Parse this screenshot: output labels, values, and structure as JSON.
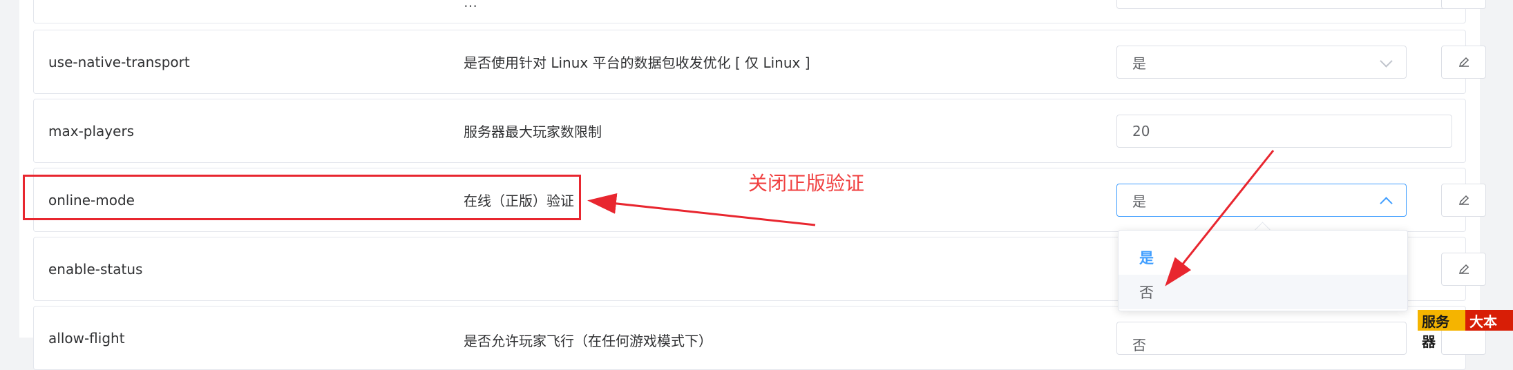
{
  "rows": [
    {
      "key": "",
      "desc": "…",
      "value": "",
      "type": "select"
    },
    {
      "key": "use-native-transport",
      "desc": "是否使用针对 Linux 平台的数据包收发优化 [ 仅 Linux ]",
      "value": "是",
      "type": "select"
    },
    {
      "key": "max-players",
      "desc": "服务器最大玩家数限制",
      "value": "20",
      "type": "input"
    },
    {
      "key": "online-mode",
      "desc": "在线（正版）验证",
      "value": "是",
      "type": "select"
    },
    {
      "key": "enable-status",
      "desc": "",
      "value": "",
      "type": "select"
    },
    {
      "key": "allow-flight",
      "desc": "是否允许玩家飞行（在任何游戏模式下）",
      "value": "否",
      "type": "select"
    }
  ],
  "dropdown": {
    "options": [
      "是",
      "否"
    ],
    "selected": "是",
    "hovered": "否"
  },
  "annotation": {
    "text": "关闭正版验证",
    "color": "#f04040"
  },
  "watermark": {
    "part1": "服务器",
    "part2": "大本营"
  },
  "icons": {
    "edit": "pencil-icon",
    "chevron": "chevron-down-icon",
    "chevron_open": "chevron-up-icon"
  },
  "colors": {
    "accent": "#409eff",
    "annotation": "#e8262f",
    "border": "#dcdfe6"
  }
}
